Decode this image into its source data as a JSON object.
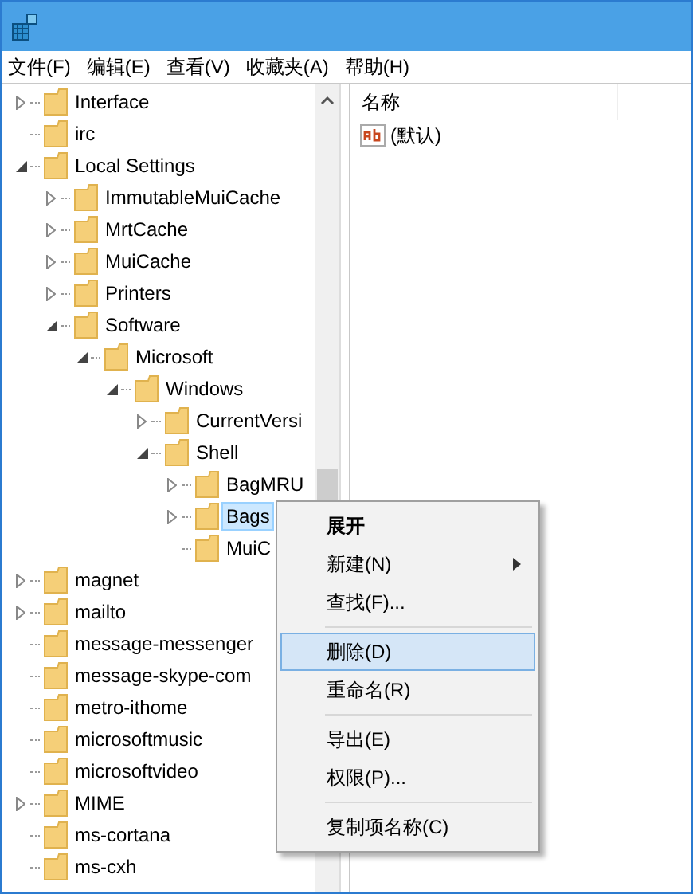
{
  "menu_bar": [
    "文件(F)",
    "编辑(E)",
    "查看(V)",
    "收藏夹(A)",
    "帮助(H)"
  ],
  "tree": [
    {
      "label": "Interface",
      "expanded": false,
      "selected": false
    },
    {
      "label": "irc",
      "selected": false
    },
    {
      "label": "Local Settings",
      "expanded": true,
      "selected": false,
      "children": [
        {
          "label": "ImmutableMuiCache",
          "expanded": false,
          "selected": false
        },
        {
          "label": "MrtCache",
          "expanded": false,
          "selected": false
        },
        {
          "label": "MuiCache",
          "expanded": false,
          "selected": false
        },
        {
          "label": "Printers",
          "expanded": false,
          "selected": false
        },
        {
          "label": "Software",
          "expanded": true,
          "selected": false,
          "children": [
            {
              "label": "Microsoft",
              "expanded": true,
              "selected": false,
              "children": [
                {
                  "label": "Windows",
                  "expanded": true,
                  "selected": false,
                  "children": [
                    {
                      "label": "CurrentVersi",
                      "expanded": false,
                      "selected": false
                    },
                    {
                      "label": "Shell",
                      "expanded": true,
                      "selected": false,
                      "children": [
                        {
                          "label": "BagMRU",
                          "expanded": false,
                          "selected": false
                        },
                        {
                          "label": "Bags",
                          "expanded": false,
                          "selected": true
                        },
                        {
                          "label": "MuiC",
                          "selected": false
                        }
                      ]
                    }
                  ]
                }
              ]
            }
          ]
        }
      ]
    },
    {
      "label": "magnet",
      "expanded": false,
      "selected": false
    },
    {
      "label": "mailto",
      "expanded": false,
      "selected": false
    },
    {
      "label": "message-messenger",
      "selected": false
    },
    {
      "label": "message-skype-com",
      "selected": false
    },
    {
      "label": "metro-ithome",
      "selected": false
    },
    {
      "label": "microsoftmusic",
      "selected": false
    },
    {
      "label": "microsoftvideo",
      "selected": false
    },
    {
      "label": "MIME",
      "expanded": false,
      "selected": false
    },
    {
      "label": "ms-cortana",
      "selected": false
    },
    {
      "label": "ms-cxh",
      "selected": false
    }
  ],
  "values_pane": {
    "column_1": "名称",
    "rows": [
      {
        "name": "(默认)"
      }
    ]
  },
  "context_menu": [
    {
      "kind": "item",
      "label": "展开",
      "default": true,
      "submenu": false,
      "selected": false
    },
    {
      "kind": "item",
      "label": "新建(N)",
      "default": false,
      "submenu": true,
      "selected": false
    },
    {
      "kind": "item",
      "label": "查找(F)...",
      "default": false,
      "submenu": false,
      "selected": false
    },
    {
      "kind": "separator"
    },
    {
      "kind": "item",
      "label": "删除(D)",
      "default": false,
      "submenu": false,
      "selected": true
    },
    {
      "kind": "item",
      "label": "重命名(R)",
      "default": false,
      "submenu": false,
      "selected": false
    },
    {
      "kind": "separator"
    },
    {
      "kind": "item",
      "label": "导出(E)",
      "default": false,
      "submenu": false,
      "selected": false
    },
    {
      "kind": "item",
      "label": "权限(P)...",
      "default": false,
      "submenu": false,
      "selected": false
    },
    {
      "kind": "separator"
    },
    {
      "kind": "item",
      "label": "复制项名称(C)",
      "default": false,
      "submenu": false,
      "selected": false
    }
  ]
}
